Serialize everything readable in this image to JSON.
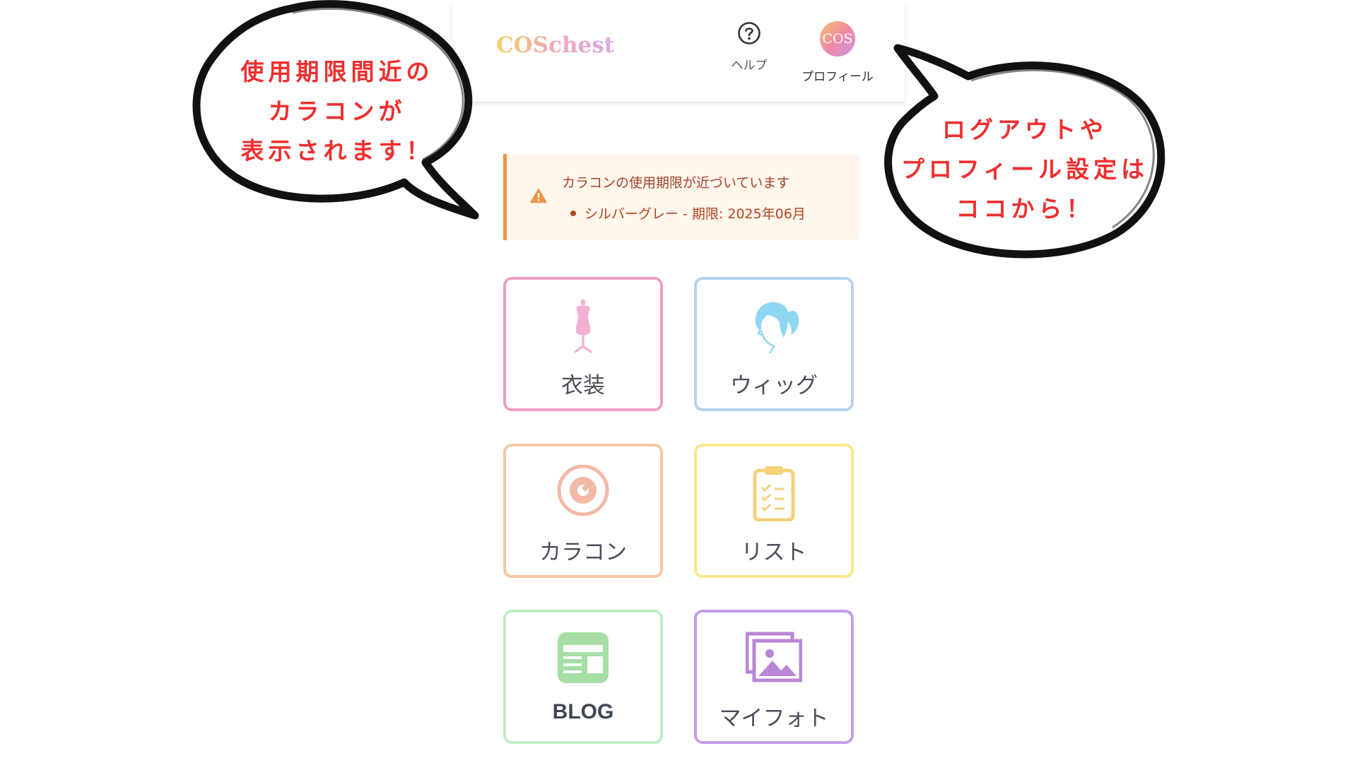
{
  "header": {
    "logo": "COSchest",
    "help_label": "ヘルプ",
    "avatar_text": "COS",
    "profile_label": "プロフィール"
  },
  "alert": {
    "title": "カラコンの使用期限が近づいています",
    "items": [
      "シルバーグレー - 期限: 2025年06月"
    ]
  },
  "tiles": [
    {
      "label": "衣装",
      "icon": "dress-form-icon",
      "color": "#ec9fc8"
    },
    {
      "label": "ウィッグ",
      "icon": "wig-icon",
      "color": "#b7d2f3"
    },
    {
      "label": "カラコン",
      "icon": "contact-lens-icon",
      "color": "#f4c8a4"
    },
    {
      "label": "リスト",
      "icon": "clipboard-checklist-icon",
      "color": "#fbe78a"
    },
    {
      "label": "BLOG",
      "icon": "blog-icon",
      "color": "#bfeec6"
    },
    {
      "label": "マイフォト",
      "icon": "photos-icon",
      "color": "#c69ce6"
    }
  ],
  "annotations": {
    "left_lines": [
      "使用期限間近の",
      "カラコンが",
      "表示されます！"
    ],
    "right_lines": [
      "ログアウトや",
      "プロフィール設定は",
      "ココから！"
    ],
    "text_color": "#ee2f2f"
  }
}
